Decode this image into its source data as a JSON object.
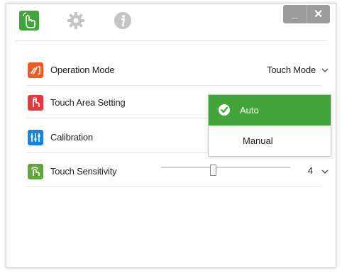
{
  "window": {
    "minimize_label": "_",
    "close_label": "✕"
  },
  "tabs": [
    {
      "name": "touch",
      "icon": "touch-hand-icon",
      "active": true
    },
    {
      "name": "settings",
      "icon": "gear-icon",
      "active": false
    },
    {
      "name": "info",
      "icon": "info-icon",
      "active": false
    }
  ],
  "settings": {
    "operation_mode": {
      "label": "Operation Mode",
      "value": "Touch Mode"
    },
    "touch_area": {
      "label": "Touch Area Setting"
    },
    "calibration": {
      "label": "Calibration"
    },
    "touch_sensitivity": {
      "label": "Touch Sensitivity",
      "value": "4",
      "slider_fraction": 0.4
    }
  },
  "dropdown": {
    "options": [
      {
        "label": "Auto",
        "selected": true
      },
      {
        "label": "Manual",
        "selected": false
      }
    ]
  },
  "colors": {
    "accent_green": "#44a43c",
    "operation_icon": "#f05a23",
    "touch_area_icon": "#e8373f",
    "calibration_icon": "#1a85d6",
    "sensitivity_icon": "#62a63b",
    "window_buttons": "#9c9c9c"
  }
}
